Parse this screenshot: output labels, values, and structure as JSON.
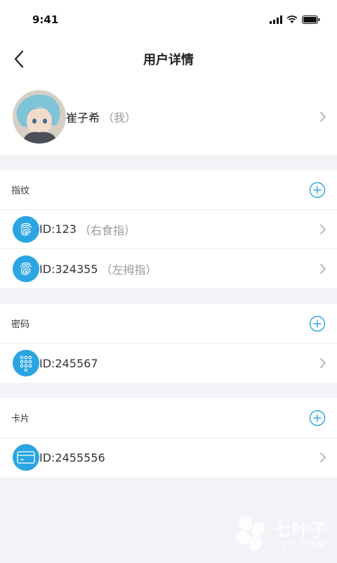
{
  "status": {
    "time": "9:41"
  },
  "nav": {
    "title": "用户详情"
  },
  "profile": {
    "name": "崔子希",
    "tag": "（我）"
  },
  "sections": {
    "fingerprint": {
      "title": "指纹",
      "items": [
        {
          "id": "ID:123",
          "tag": "（右食指）"
        },
        {
          "id": "ID:324355",
          "tag": "（左拇指）"
        }
      ]
    },
    "password": {
      "title": "密码",
      "items": [
        {
          "id": "ID:245567"
        }
      ]
    },
    "card": {
      "title": "卡片",
      "items": [
        {
          "id": "ID:2455556"
        }
      ]
    }
  },
  "watermark": {
    "top": "七叶子",
    "bottom": "7YZ.COM"
  },
  "colors": {
    "accent": "#2ba4e2",
    "background": "#f2f3f7"
  }
}
